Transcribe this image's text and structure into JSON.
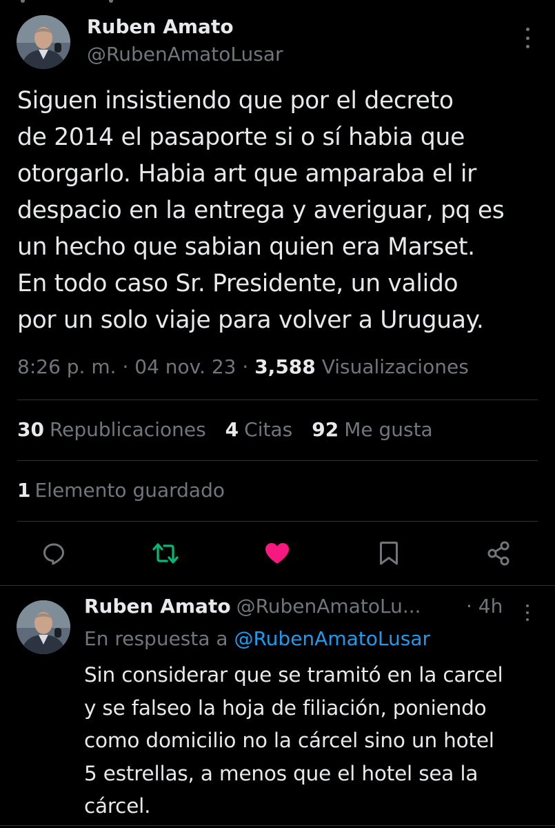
{
  "tweet": {
    "author_name": "Ruben Amato",
    "author_handle": "@RubenAmatoLusar",
    "text": "Siguen insistiendo que por el decreto\nde 2014 el pasaporte si o sí habia  que\notorgarlo. Habia art que amparaba el  ir\ndespacio en la entrega y averiguar, pq es\nun hecho que sabian quien era Marset.\nEn todo caso Sr. Presidente, un valido\npor un solo viaje para volver a Uruguay.",
    "time": "8:26 p. m.",
    "separator": "·",
    "date": "04 nov. 23",
    "views_count": "3,588",
    "views_label": "Visualizaciones",
    "stats": {
      "reposts_count": "30",
      "reposts_label": "Republicaciones",
      "quotes_count": "4",
      "quotes_label": "Citas",
      "likes_count": "92",
      "likes_label": "Me gusta"
    },
    "bookmarks_count": "1",
    "bookmarks_label": "Elemento guardado"
  },
  "actions": {
    "reply_icon": "reply-icon",
    "repost_icon": "repost-icon",
    "like_icon": "heart-icon",
    "bookmark_icon": "bookmark-icon",
    "share_icon": "share-icon"
  },
  "reply": {
    "author_name": "Ruben Amato",
    "author_handle": "@RubenAmatoLu...",
    "time": "· 4h",
    "replying_prefix": "En respuesta a",
    "replying_to": "@RubenAmatoLusar",
    "text": "Sin considerar que se tramitó en la carcel\ny se falseo la hoja de filiación, poniendo\ncomo domicilio no la cárcel sino un hotel\n5 estrellas, a menos que el hotel sea la\ncárcel."
  },
  "colors": {
    "background": "#000000",
    "text_primary": "#e7e9ea",
    "text_secondary": "#71767b",
    "link": "#1d9bf0",
    "repost_active": "#00ba7c",
    "like_active": "#f91880",
    "divider": "#2f3336"
  }
}
